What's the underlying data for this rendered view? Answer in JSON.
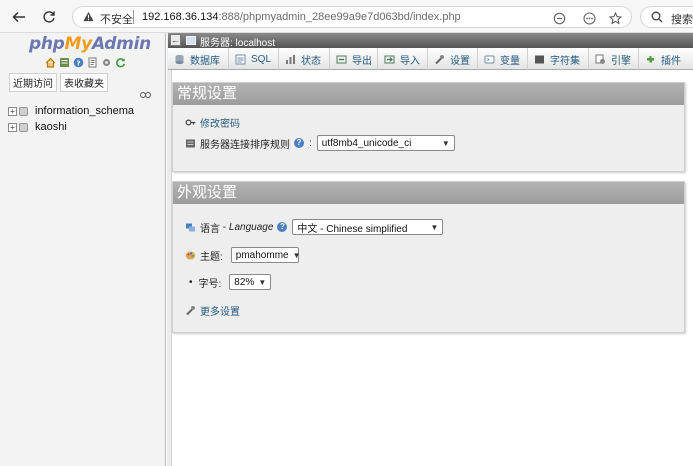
{
  "browser": {
    "security_text": "不安全",
    "url_host": "192.168.36.134",
    "url_rest": ":888/phpmyadmin_28ee99a9e7d063bd/index.php",
    "search_label": "搜索"
  },
  "nav_panel": {
    "logo_php": "php",
    "logo_my": "My",
    "logo_admin": "Admin",
    "links": [
      "近期访问",
      "表收藏夹"
    ],
    "databases": [
      "information_schema",
      "kaoshi"
    ]
  },
  "server_bar": {
    "collapse": "←",
    "label": "服务器: localhost"
  },
  "tabs": [
    {
      "label": "数据库",
      "icon": "database-icon"
    },
    {
      "label": "SQL",
      "icon": "sql-icon"
    },
    {
      "label": "状态",
      "icon": "status-icon"
    },
    {
      "label": "导出",
      "icon": "export-icon"
    },
    {
      "label": "导入",
      "icon": "import-icon"
    },
    {
      "label": "设置",
      "icon": "settings-icon"
    },
    {
      "label": "变量",
      "icon": "variables-icon"
    },
    {
      "label": "字符集",
      "icon": "charset-icon"
    },
    {
      "label": "引擎",
      "icon": "engine-icon"
    },
    {
      "label": "插件",
      "icon": "plugin-icon"
    }
  ],
  "general_settings": {
    "title": "常规设置",
    "change_password": "修改密码",
    "collation_label": "服务器连接排序规则",
    "collation_value": "utf8mb4_unicode_ci"
  },
  "appearance_settings": {
    "title": "外观设置",
    "language_label": "语言",
    "language_label_en": "Language",
    "language_value": "中文 - Chinese simplified",
    "theme_label": "主题:",
    "theme_value": "pmahomme",
    "font_label": "字号:",
    "font_value": "82%",
    "more_settings": "更多设置"
  },
  "colors": {
    "link": "#235a81",
    "panel_header": "#a6a6a6",
    "logo_blue": "#6c78af",
    "logo_orange": "#f29b1d"
  }
}
